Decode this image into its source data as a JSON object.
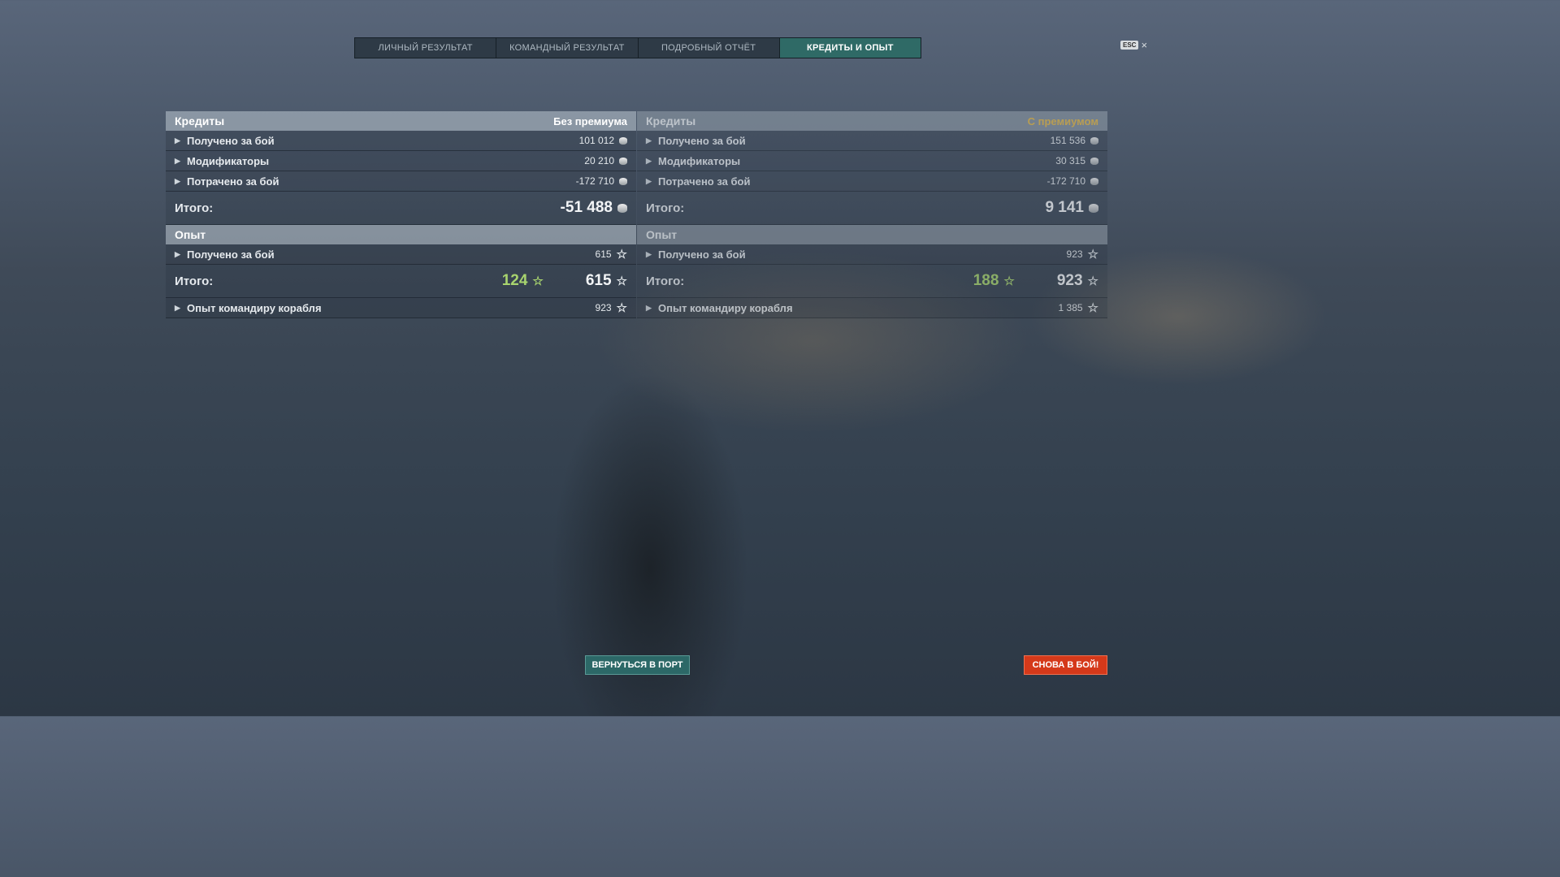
{
  "tabs": [
    {
      "label": "ЛИЧНЫЙ РЕЗУЛЬТАТ"
    },
    {
      "label": "КОМАНДНЫЙ РЕЗУЛЬТАТ"
    },
    {
      "label": "ПОДРОБНЫЙ ОТЧЁТ"
    },
    {
      "label": "КРЕДИТЫ И ОПЫТ"
    }
  ],
  "esc": {
    "key": "ESC",
    "close": "×"
  },
  "without_premium": {
    "credits": {
      "title": "Кредиты",
      "subtitle": "Без премиума",
      "rows": [
        {
          "label": "Получено за бой",
          "value": "101 012"
        },
        {
          "label": "Модификаторы",
          "value": "20 210"
        },
        {
          "label": "Потрачено за бой",
          "value": "-172 710"
        }
      ],
      "total_label": "Итого:",
      "total_value": "-51 488"
    },
    "xp": {
      "title": "Опыт",
      "rows": [
        {
          "label": "Получено за бой",
          "value": "615"
        }
      ],
      "total_label": "Итого:",
      "total_bonus": "124",
      "total_value": "615",
      "commander": {
        "label": "Опыт командиру корабля",
        "value": "923"
      }
    }
  },
  "with_premium": {
    "credits": {
      "title": "Кредиты",
      "subtitle": "С премиумом",
      "rows": [
        {
          "label": "Получено за бой",
          "value": "151 536"
        },
        {
          "label": "Модификаторы",
          "value": "30 315"
        },
        {
          "label": "Потрачено за бой",
          "value": "-172 710"
        }
      ],
      "total_label": "Итого:",
      "total_value": "9 141"
    },
    "xp": {
      "title": "Опыт",
      "rows": [
        {
          "label": "Получено за бой",
          "value": "923"
        }
      ],
      "total_label": "Итого:",
      "total_bonus": "188",
      "total_value": "923",
      "commander": {
        "label": "Опыт командиру корабля",
        "value": "1 385"
      }
    }
  },
  "buttons": {
    "port": "ВЕРНУТЬСЯ В ПОРТ",
    "battle": "СНОВА В БОЙ!"
  },
  "colors": {
    "accent_teal": "#2f6a66",
    "battle_red": "#d5391a",
    "premium_gold": "#e2b84a",
    "xp_green": "#a8d46e"
  },
  "icons": {
    "credit": "credit-coin-icon",
    "xp": "star-icon",
    "expand": "triangle-right-icon"
  }
}
